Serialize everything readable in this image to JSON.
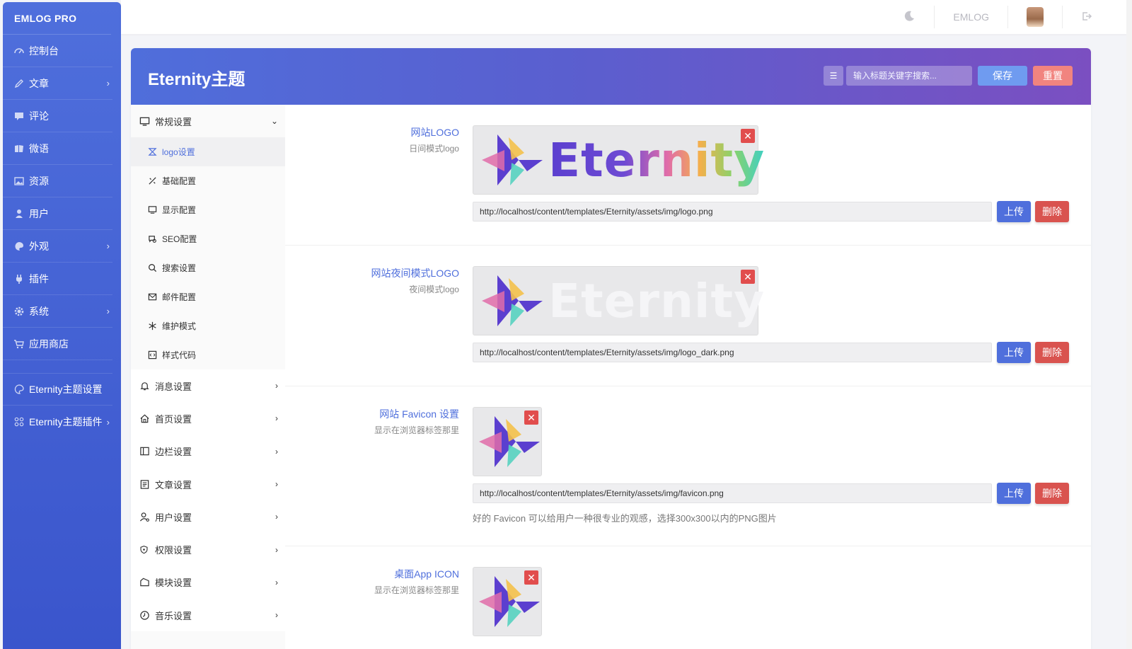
{
  "brand": "EMLOG PRO",
  "sidebar": {
    "items": [
      {
        "label": "控制台",
        "icon": "dashboard-icon",
        "chevron": false
      },
      {
        "label": "文章",
        "icon": "pencil-icon",
        "chevron": true
      },
      {
        "label": "评论",
        "icon": "comment-icon",
        "chevron": false
      },
      {
        "label": "微语",
        "icon": "note-icon",
        "chevron": false
      },
      {
        "label": "资源",
        "icon": "image-icon",
        "chevron": false
      },
      {
        "label": "用户",
        "icon": "user-icon",
        "chevron": false
      },
      {
        "label": "外观",
        "icon": "palette-icon",
        "chevron": true
      },
      {
        "label": "插件",
        "icon": "plug-icon",
        "chevron": false
      },
      {
        "label": "系统",
        "icon": "gear-icon",
        "chevron": true
      },
      {
        "label": "应用商店",
        "icon": "cart-icon",
        "chevron": false
      }
    ],
    "extra": [
      {
        "label": "Eternity主题设置",
        "icon": "palette-icon",
        "chevron": false
      },
      {
        "label": "Eternity主题插件",
        "icon": "grid-icon",
        "chevron": true
      }
    ]
  },
  "topbar": {
    "site_name": "EMLOG",
    "theme_toggle_icon": "moon-icon",
    "logout_icon": "logout-icon"
  },
  "panel": {
    "title": "Eternity主题",
    "search_placeholder": "输入标题关键字搜索...",
    "save_label": "保存",
    "reset_label": "重置",
    "menu_toggle_glyph": "☰"
  },
  "settings_menu": {
    "general": {
      "label": "常规设置",
      "subs": [
        {
          "label": "logo设置",
          "icon": "logo-icon",
          "active": true
        },
        {
          "label": "基础配置",
          "icon": "tools-icon",
          "active": false
        },
        {
          "label": "显示配置",
          "icon": "monitor-icon",
          "active": false
        },
        {
          "label": "SEO配置",
          "icon": "seo-icon",
          "active": false
        },
        {
          "label": "搜索设置",
          "icon": "search-icon",
          "active": false
        },
        {
          "label": "邮件配置",
          "icon": "mail-icon",
          "active": false
        },
        {
          "label": "维护模式",
          "icon": "snowflake-icon",
          "active": false
        },
        {
          "label": "样式代码",
          "icon": "code-icon",
          "active": false
        }
      ]
    },
    "groups": [
      {
        "label": "消息设置",
        "icon": "bell-icon"
      },
      {
        "label": "首页设置",
        "icon": "home-icon"
      },
      {
        "label": "边栏设置",
        "icon": "sidebar-icon"
      },
      {
        "label": "文章设置",
        "icon": "document-icon"
      },
      {
        "label": "用户设置",
        "icon": "user-gear-icon"
      },
      {
        "label": "权限设置",
        "icon": "shield-icon"
      },
      {
        "label": "模块设置",
        "icon": "module-icon"
      },
      {
        "label": "音乐设置",
        "icon": "music-icon"
      }
    ]
  },
  "fields": [
    {
      "label": "网站LOGO",
      "desc": "日间模式logo",
      "url": "http://localhost/content/templates/Eternity/assets/img/logo.png",
      "preview_text": "Eternity",
      "help": ""
    },
    {
      "label": "网站夜间模式LOGO",
      "desc": "夜间模式logo",
      "url": "http://localhost/content/templates/Eternity/assets/img/logo_dark.png",
      "preview_text": "Eternity",
      "help": ""
    },
    {
      "label": "网站 Favicon 设置",
      "desc": "显示在浏览器标签那里",
      "url": "http://localhost/content/templates/Eternity/assets/img/favicon.png",
      "preview_text": "",
      "help": "好的 Favicon 可以给用户一种很专业的观感，选择300x300以内的PNG图片"
    },
    {
      "label": "桌面App ICON",
      "desc": "显示在浏览器标签那里",
      "url": "",
      "preview_text": "",
      "help": ""
    }
  ],
  "buttons": {
    "upload": "上传",
    "delete": "删除",
    "remove_glyph": "✕"
  },
  "colors": {
    "accent": "#4f6fdc",
    "danger": "#d9534f",
    "header_start": "#4f6edb",
    "header_end": "#7b4fc1"
  }
}
